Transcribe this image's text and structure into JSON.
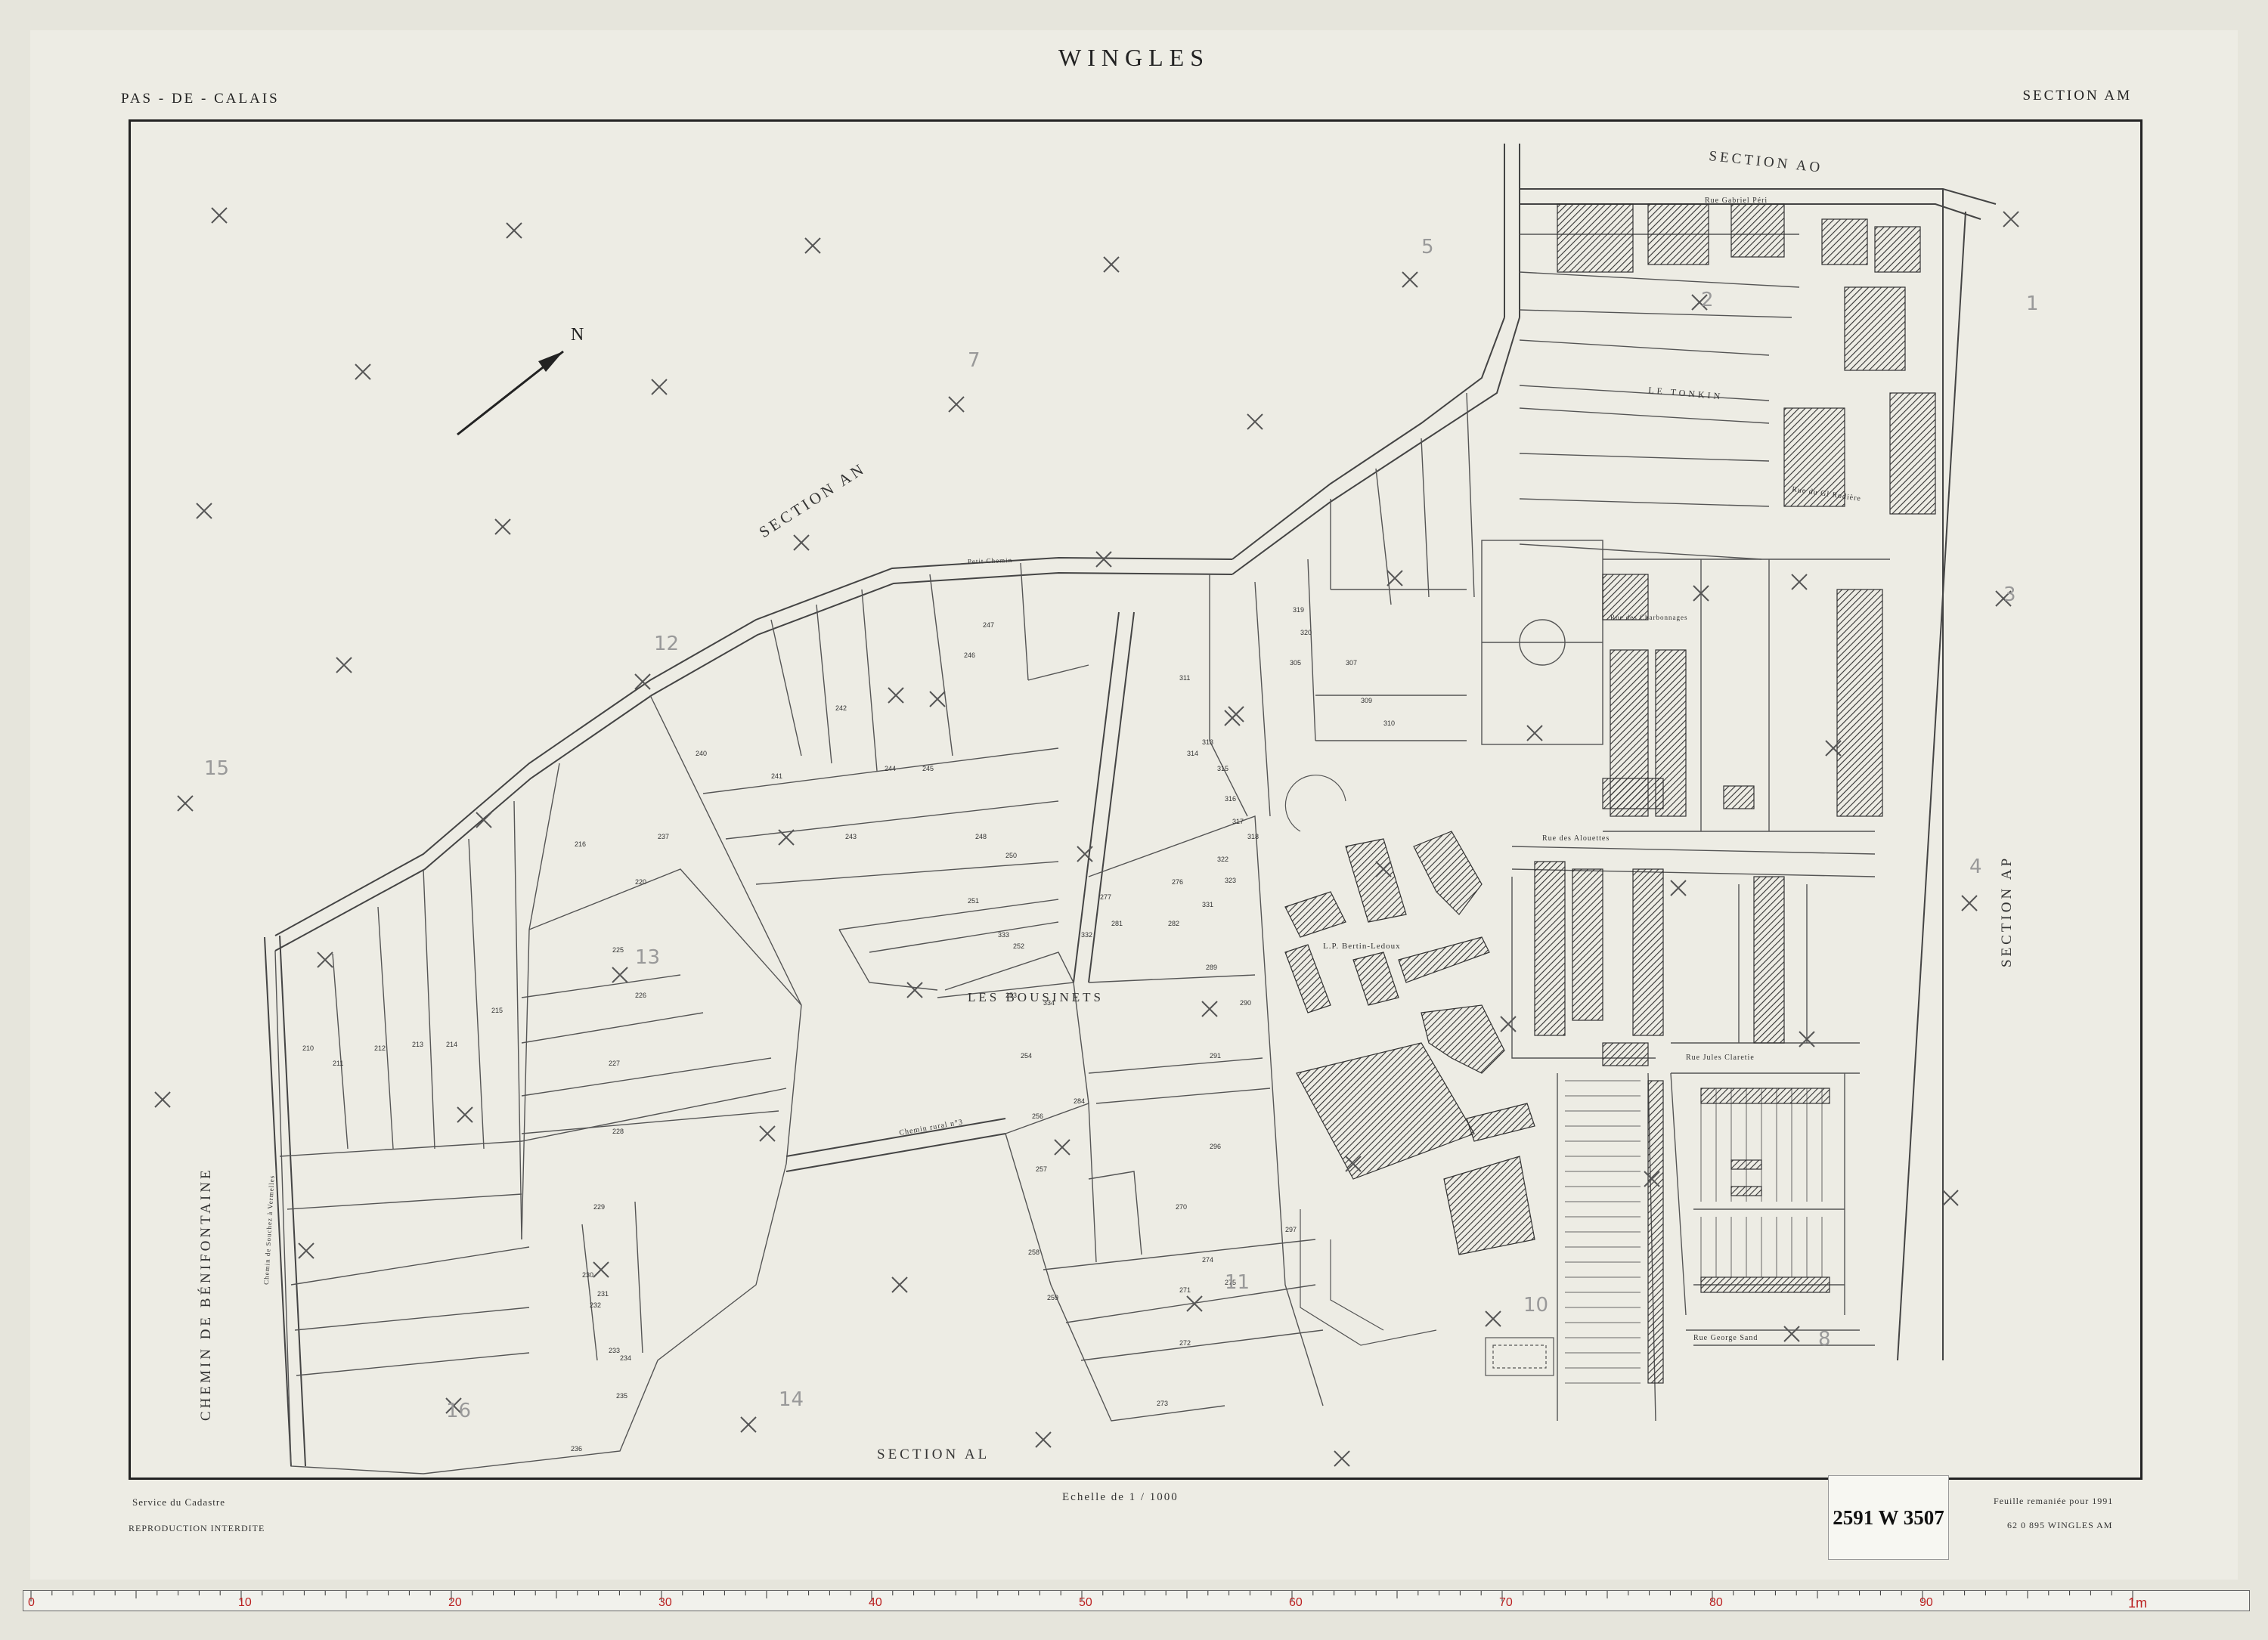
{
  "header": {
    "title": "WINGLES",
    "department": "PAS - DE - CALAIS",
    "section": "SECTION AM"
  },
  "footer": {
    "service": "Service du Cadastre",
    "reproduction": "REPRODUCTION INTERDITE",
    "scale": "Echelle de 1 / 1000",
    "remaniee": "Feuille remaniée pour 1991",
    "sheet_ref": "62 0 895 WINGLES AM",
    "archive_label": "2591 W 3507"
  },
  "map": {
    "neighbor_sections": [
      "SECTION AN",
      "SECTION AO",
      "SECTION AP",
      "SECTION AL"
    ],
    "lieux_dits": [
      "LES BOUSINETS",
      "LE TONKIN"
    ],
    "roads": [
      "CHEMIN DE BÉNIFONTAINE",
      "Rue Gabriel Péri",
      "Rue du Gl Rodière",
      "Rue des Charbonnages",
      "Rue des Alouettes",
      "Rue Jules Claretie",
      "Rue George Sand",
      "Chemin rural n°3",
      "Chemin de Souchez à Vermelles",
      "Petit Chemin"
    ],
    "buildings": [
      "L.P. Bertin-Ledoux"
    ],
    "north_label": "N",
    "handwritten_section_numbers": [
      "1",
      "2",
      "3",
      "4",
      "5",
      "7",
      "8",
      "10",
      "11",
      "12",
      "13",
      "14",
      "15",
      "16"
    ],
    "parcels": [
      {
        "num": "210"
      },
      {
        "num": "211"
      },
      {
        "num": "212"
      },
      {
        "num": "213"
      },
      {
        "num": "214"
      },
      {
        "num": "215"
      },
      {
        "num": "216"
      },
      {
        "num": "220"
      },
      {
        "num": "225"
      },
      {
        "num": "226"
      },
      {
        "num": "227"
      },
      {
        "num": "228"
      },
      {
        "num": "229"
      },
      {
        "num": "230"
      },
      {
        "num": "231"
      },
      {
        "num": "232"
      },
      {
        "num": "233"
      },
      {
        "num": "234"
      },
      {
        "num": "235"
      },
      {
        "num": "236"
      },
      {
        "num": "237"
      },
      {
        "num": "240"
      },
      {
        "num": "241"
      },
      {
        "num": "242"
      },
      {
        "num": "243"
      },
      {
        "num": "244"
      },
      {
        "num": "245"
      },
      {
        "num": "246"
      },
      {
        "num": "247"
      },
      {
        "num": "248"
      },
      {
        "num": "250"
      },
      {
        "num": "251"
      },
      {
        "num": "252"
      },
      {
        "num": "253"
      },
      {
        "num": "254"
      },
      {
        "num": "256"
      },
      {
        "num": "257"
      },
      {
        "num": "258"
      },
      {
        "num": "259"
      },
      {
        "num": "270"
      },
      {
        "num": "271"
      },
      {
        "num": "272"
      },
      {
        "num": "273"
      },
      {
        "num": "274"
      },
      {
        "num": "275"
      },
      {
        "num": "276"
      },
      {
        "num": "277"
      },
      {
        "num": "281"
      },
      {
        "num": "282"
      },
      {
        "num": "284"
      },
      {
        "num": "289"
      },
      {
        "num": "290"
      },
      {
        "num": "291"
      },
      {
        "num": "296"
      },
      {
        "num": "297"
      },
      {
        "num": "305"
      },
      {
        "num": "307"
      },
      {
        "num": "309"
      },
      {
        "num": "310"
      },
      {
        "num": "311"
      },
      {
        "num": "313"
      },
      {
        "num": "314"
      },
      {
        "num": "315"
      },
      {
        "num": "316"
      },
      {
        "num": "317"
      },
      {
        "num": "318"
      },
      {
        "num": "319"
      },
      {
        "num": "320"
      },
      {
        "num": "322"
      },
      {
        "num": "323"
      },
      {
        "num": "331"
      },
      {
        "num": "332"
      },
      {
        "num": "333"
      },
      {
        "num": "334"
      }
    ]
  },
  "ruler": {
    "unit": "1m",
    "major_labels": [
      "0",
      "10",
      "20",
      "30",
      "40",
      "50",
      "60",
      "70",
      "80",
      "90"
    ]
  }
}
